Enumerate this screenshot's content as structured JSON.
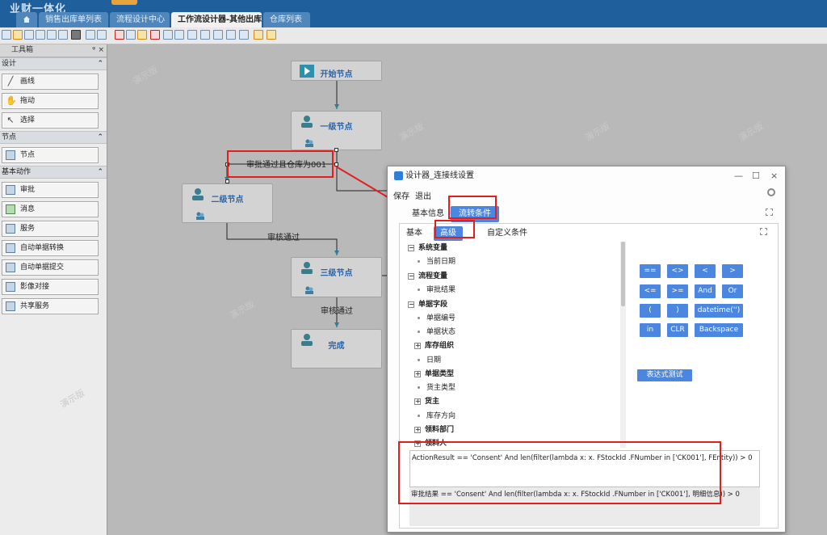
{
  "app": {
    "brand": "业财一体化",
    "home_icon": "home-icon"
  },
  "tabs": [
    {
      "label": "销售出库单列表",
      "active": false
    },
    {
      "label": "流程设计中心",
      "active": false
    },
    {
      "label": "工作流设计器-其他出库",
      "active": true,
      "close": "×"
    },
    {
      "label": "仓库列表",
      "active": false
    }
  ],
  "toolbox": {
    "title": "工具箱",
    "pin": "ᵠ",
    "close": "×",
    "sections": [
      {
        "title": "设计",
        "chev": "⌃",
        "items": [
          "画线",
          "拖动",
          "选择"
        ]
      },
      {
        "title": "节点",
        "chev": "⌃",
        "items": [
          "节点"
        ]
      },
      {
        "title": "基本动作",
        "chev": "⌃",
        "items": [
          "审批",
          "消息",
          "服务",
          "自动单据转换",
          "自动单据提交",
          "影像对接",
          "共享服务"
        ]
      }
    ]
  },
  "canvas": {
    "watermark": "演示版",
    "nodes": {
      "start": "开始节点",
      "level1": "一级节点",
      "level2": "二级节点",
      "level3": "三级节点",
      "done": "完成"
    },
    "edges": {
      "condition1": "审批通过且仓库为001",
      "review1": "审核通过",
      "review2": "审核通过"
    }
  },
  "dialog": {
    "title": "设计器_连接线设置",
    "minimize": "—",
    "maximize": "☐",
    "close": "×",
    "menu": {
      "save": "保存",
      "exit": "退出"
    },
    "outer_tabs": {
      "basic_info": "基本信息",
      "flow_condition": "流转条件"
    },
    "inner_tabs": {
      "basic": "基本",
      "advanced": "高级",
      "custom": "自定义条件"
    },
    "tree": {
      "system_var": "系统变量",
      "current_date": "当前日期",
      "flow_var": "流程变量",
      "approval_result": "审批结果",
      "doc_fields": "单据字段",
      "doc_no": "单据编号",
      "doc_status": "单据状态",
      "stock_org": "库存组织",
      "date": "日期",
      "doc_type": "单据类型",
      "owner_type": "货主类型",
      "owner": "货主",
      "stock_direction": "库存方向",
      "dept": "领料部门",
      "picker": "领料人"
    },
    "operators": {
      "eq": "==",
      "neq": "<>",
      "lt": "<",
      "gt": ">",
      "le": "<=",
      "ge": ">=",
      "and": "And",
      "or": "Or",
      "lparen": "(",
      "rparen": ")",
      "datetime": "datetime('')",
      "in": "in",
      "clr": "CLR",
      "backspace": "Backspace"
    },
    "test_button": "表达式测试",
    "expression": "ActionResult == 'Consent' And  len(filter(lambda x: x. FStockId .FNumber in ['CK001'], FEntity)) >  0",
    "expression_display": "审批结果 == 'Consent' And  len(filter(lambda x: x. FStockId .FNumber in ['CK001'], 明细信息)) >  0"
  }
}
